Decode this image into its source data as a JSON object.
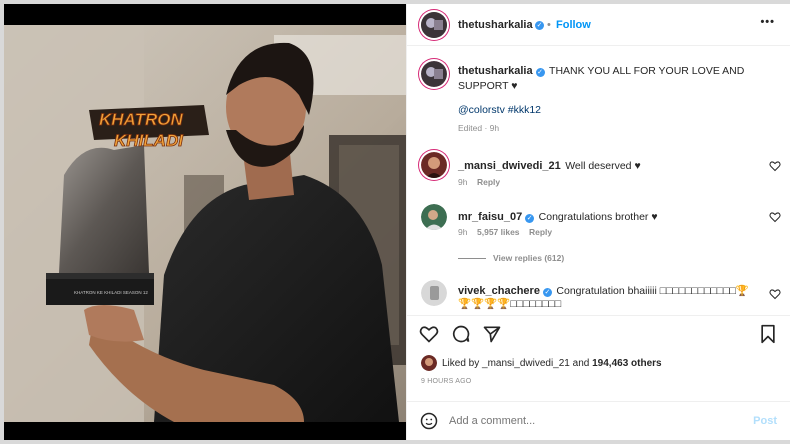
{
  "header": {
    "username": "thetusharkalia",
    "follow_label": "Follow",
    "more_label": "•••"
  },
  "caption": {
    "username": "thetusharkalia",
    "text": "THANK YOU ALL FOR YOUR LOVE AND SUPPORT ♥",
    "tags": "@colorstv #kkk12",
    "meta": "Edited · 9h"
  },
  "comments": [
    {
      "username": "_mansi_dwivedi_21",
      "text": "Well deserved ♥",
      "time": "9h",
      "likes": "",
      "reply": "Reply",
      "verified": false
    },
    {
      "username": "mr_faisu_07",
      "text": "Congratulations brother ♥",
      "time": "9h",
      "likes": "5,957 likes",
      "reply": "Reply",
      "verified": true,
      "view_replies": "View replies (612)"
    },
    {
      "username": "vivek_chachere",
      "text": "Congratulation bhaiiiii 🏆🏆🏆🏆🏆🏆🏆🏆🏆🏆🏆🏆🏆🏆🏆🏆",
      "text_display": "Congratulation bhaiiiii □□□□□□□□□□□□🏆",
      "text_line2": "🏆🏆🏆🏆□□□□□□□□",
      "verified": true
    }
  ],
  "actions": {
    "liked_by_prefix": "Liked by",
    "liked_by_user": "_mansi_dwivedi_21",
    "liked_by_and": "and",
    "liked_by_count": "194,463 others",
    "time_ago": "9 HOURS AGO"
  },
  "add_comment": {
    "placeholder": "Add a comment...",
    "post_label": "Post"
  },
  "photo": {
    "trophy_line1": "KHATRON",
    "trophy_line2": "KHILADI",
    "trophy_plate": "KHATRON KE KHILADI SEASON 12"
  },
  "colors": {
    "accent": "#0095f6",
    "verified": "#3897f0",
    "text": "#262626",
    "muted": "#8e8e8e"
  }
}
